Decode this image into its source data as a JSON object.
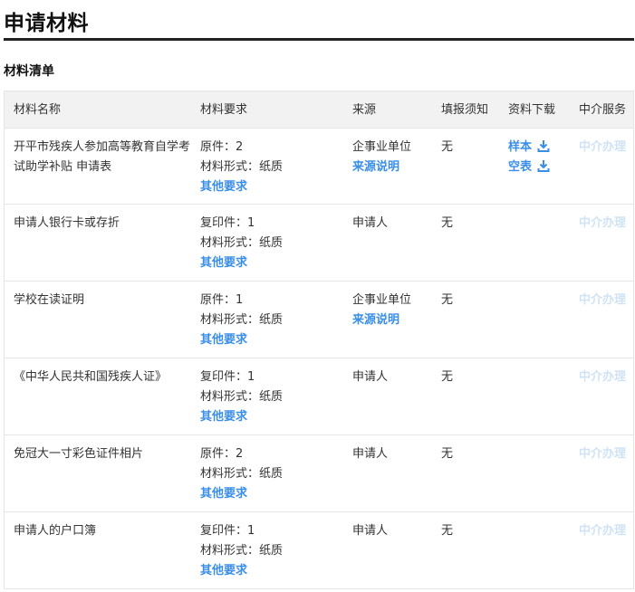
{
  "page": {
    "title": "申请材料",
    "section_title": "材料清单"
  },
  "table": {
    "headers": {
      "name": "材料名称",
      "requirement": "材料要求",
      "source": "来源",
      "fill_notice": "填报须知",
      "download": "资料下载",
      "service": "中介服务"
    },
    "rows": [
      {
        "name": "开平市残疾人参加高等教育自学考试助学补贴 申请表",
        "req_count": "原件：2",
        "req_form": "材料形式：纸质",
        "req_other": "其他要求",
        "source": "企事业单位",
        "source_note": "来源说明",
        "fill": "无",
        "dl_sample": "样本",
        "dl_blank": "空表",
        "service": "中介办理"
      },
      {
        "name": "申请人银行卡或存折",
        "req_count": "复印件：1",
        "req_form": "材料形式：纸质",
        "req_other": "其他要求",
        "source": "申请人",
        "source_note": "",
        "fill": "无",
        "service": "中介办理"
      },
      {
        "name": "学校在读证明",
        "req_count": "原件：1",
        "req_form": "材料形式：纸质",
        "req_other": "其他要求",
        "source": "企事业单位",
        "source_note": "来源说明",
        "fill": "无",
        "service": "中介办理"
      },
      {
        "name": "《中华人民共和国残疾人证》",
        "req_count": "复印件：1",
        "req_form": "材料形式：纸质",
        "req_other": "其他要求",
        "source": "申请人",
        "source_note": "",
        "fill": "无",
        "service": "中介办理"
      },
      {
        "name": "免冠大一寸彩色证件相片",
        "req_count": "原件：2",
        "req_form": "材料形式：纸质",
        "req_other": "其他要求",
        "source": "申请人",
        "source_note": "",
        "fill": "无",
        "service": "中介办理"
      },
      {
        "name": "申请人的户口簿",
        "req_count": "复印件：1",
        "req_form": "材料形式：纸质",
        "req_other": "其他要求",
        "source": "申请人",
        "source_note": "",
        "fill": "无",
        "service": "中介办理"
      }
    ]
  },
  "colors": {
    "link": "#3a8ee6",
    "service_disabled": "#cfe3f5",
    "header_bg": "#f2f2f2"
  },
  "icons": {
    "download": "download-icon"
  }
}
